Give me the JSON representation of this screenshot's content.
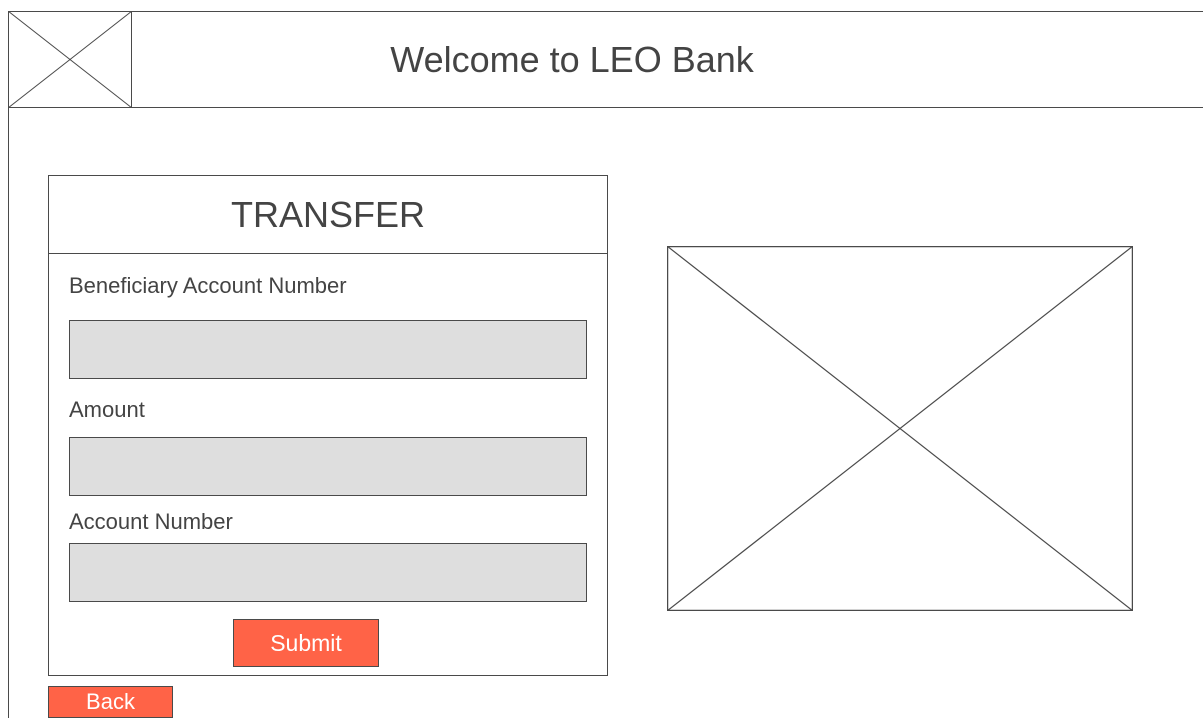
{
  "header": {
    "title": "Welcome to LEO Bank",
    "logo_icon": "image-placeholder-icon"
  },
  "transfer": {
    "title": "TRANSFER",
    "fields": [
      {
        "label": "Beneficiary Account Number",
        "value": ""
      },
      {
        "label": "Amount",
        "value": ""
      },
      {
        "label": "Account Number",
        "value": ""
      }
    ],
    "submit_label": "Submit"
  },
  "back_label": "Back",
  "side_image_icon": "image-placeholder-icon",
  "colors": {
    "accent": "#ff6347",
    "input_bg": "#dedede",
    "stroke": "#4a4a4a",
    "text": "#444444"
  }
}
